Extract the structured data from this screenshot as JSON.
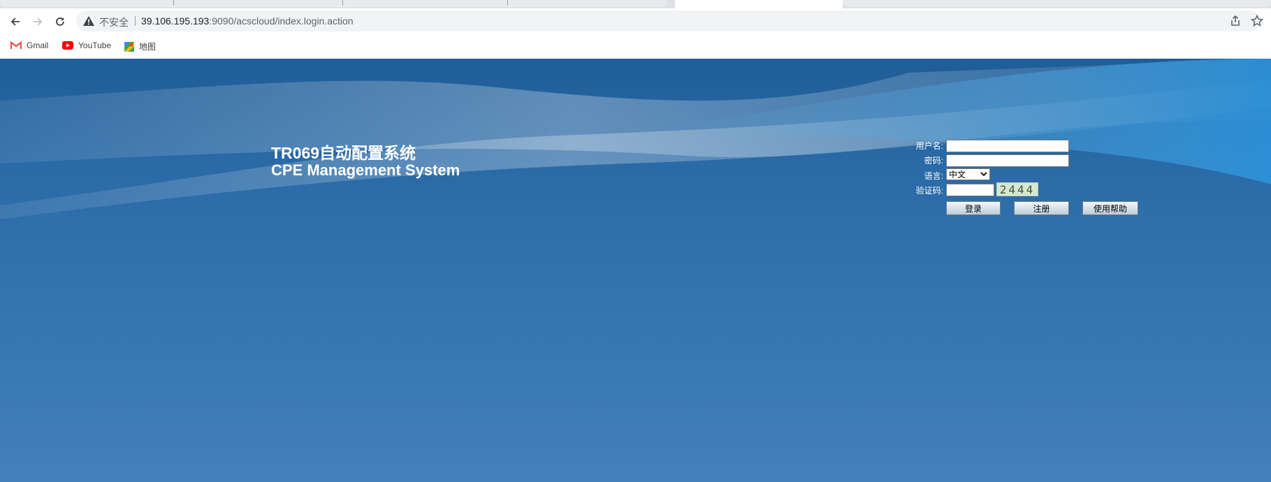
{
  "browser": {
    "security_label": "不安全",
    "url_host": "39.106.195.193",
    "url_rest": ":9090/acscloud/index.login.action",
    "bookmarks": [
      {
        "label": "Gmail",
        "icon": "gmail-icon"
      },
      {
        "label": "YouTube",
        "icon": "youtube-icon"
      },
      {
        "label": "地图",
        "icon": "maps-icon"
      }
    ]
  },
  "page": {
    "title_cn": "TR069自动配置系统",
    "title_en": "CPE Management System",
    "form": {
      "username_label": "用户名:",
      "password_label": "密码:",
      "language_label": "语言:",
      "language_selected": "中文",
      "captcha_label": "验证码:",
      "captcha_text": "2444",
      "login_button": "登录",
      "register_button": "注册",
      "help_button": "使用帮助"
    }
  },
  "colors": {
    "page_background": "#2a6aa6",
    "button_face": "#d7e2ec"
  }
}
